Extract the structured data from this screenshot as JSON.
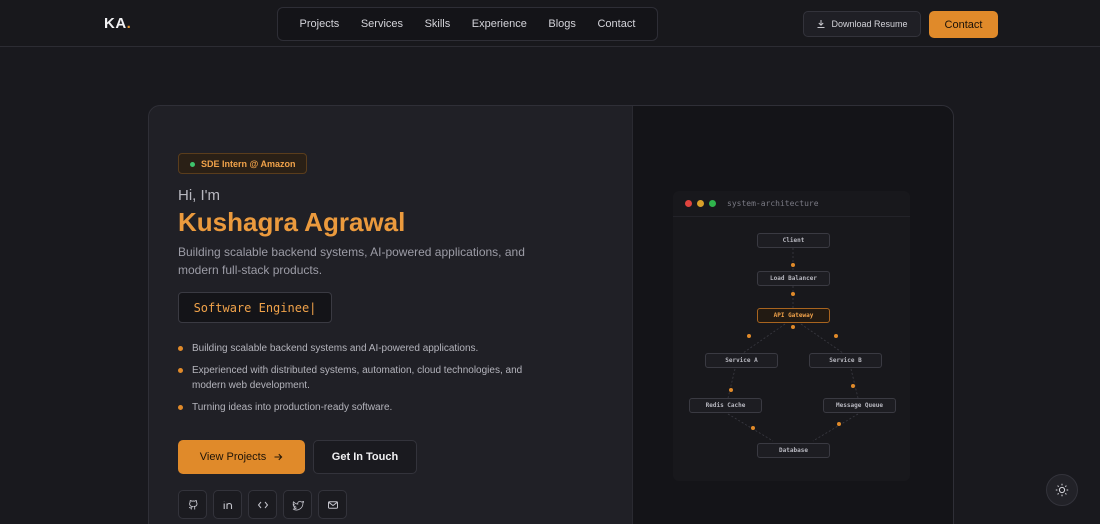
{
  "nav": {
    "logo_text": "KA",
    "logo_dot": ".",
    "links": [
      "Projects",
      "Services",
      "Skills",
      "Experience",
      "Blogs",
      "Contact"
    ],
    "download_label": "Download Resume",
    "contact_label": "Contact"
  },
  "hero": {
    "badge": "SDE Intern @ Amazon",
    "greeting": "Hi, I'm",
    "name": "Kushagra Agrawal",
    "tagline": "Building scalable backend systems, AI-powered applications, and modern full-stack products.",
    "typing_text": "Software Enginee|",
    "bullets": [
      "Building scalable backend systems and AI-powered applications.",
      "Experienced with distributed systems, automation, cloud technologies, and modern web development.",
      "Turning ideas into production-ready software."
    ],
    "primary_button": "View Projects",
    "secondary_button": "Get In Touch",
    "socials": [
      "github-icon",
      "linkedin-icon",
      "code-icon",
      "twitter-icon",
      "mail-icon"
    ]
  },
  "architecture": {
    "window_title": "system-architecture",
    "nodes": {
      "client": "Client",
      "load_balancer": "Load Balancer",
      "api_gateway": "API Gateway",
      "service_a": "Service A",
      "service_b": "Service B",
      "redis_cache": "Redis Cache",
      "message_queue": "Message Queue",
      "database": "Database"
    }
  },
  "colors": {
    "accent": "#e08a2a",
    "background": "#19191e",
    "card": "#202026"
  }
}
